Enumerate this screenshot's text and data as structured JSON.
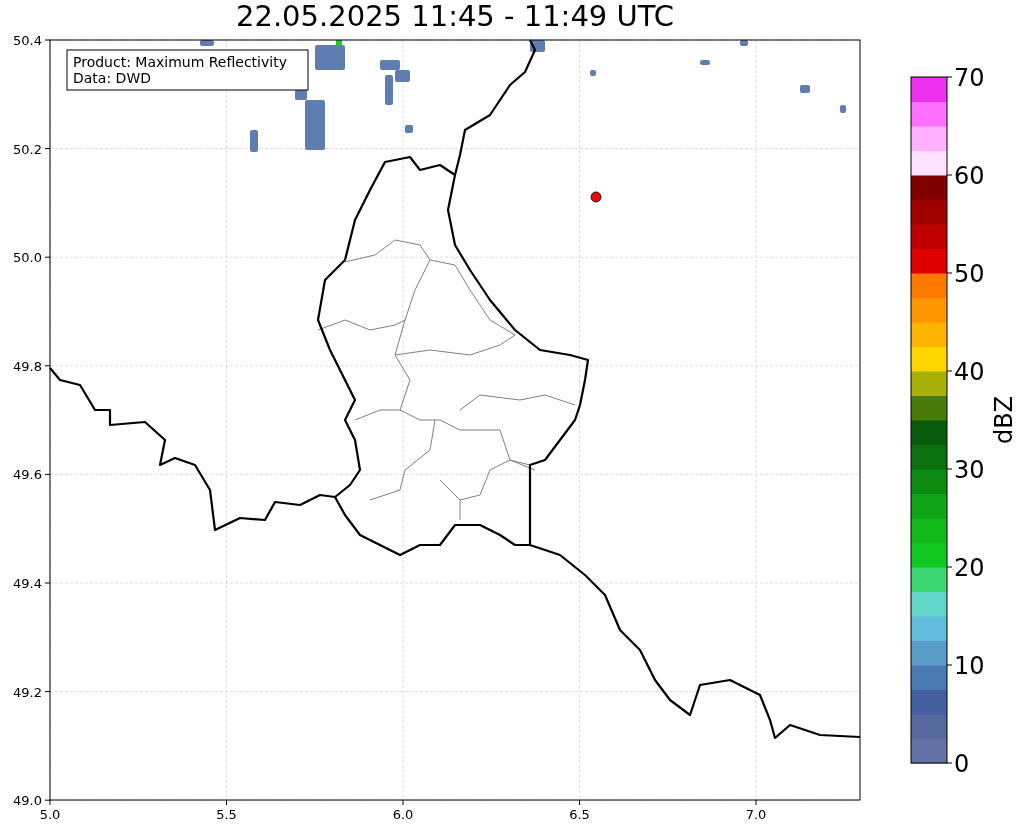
{
  "title": "22.05.2025 11:45 - 11:49 UTC",
  "info_box": [
    "Product: Maximum Reflectivity",
    "Data: DWD"
  ],
  "x_ticks": [
    "5.0",
    "5.5",
    "6.0",
    "6.5",
    "7.0"
  ],
  "y_ticks": [
    "50.4",
    "50.2",
    "50.0",
    "49.8",
    "49.6",
    "49.4",
    "49.2",
    "49.0"
  ],
  "colorbar": {
    "label": "dBZ",
    "ticks": [
      "70",
      "60",
      "50",
      "40",
      "30",
      "20",
      "10",
      "0"
    ],
    "bins": [
      {
        "color": "#6272a4"
      },
      {
        "color": "#56689e"
      },
      {
        "color": "#4460a0"
      },
      {
        "color": "#4a7ab0"
      },
      {
        "color": "#5a9ec8"
      },
      {
        "color": "#62bcdc"
      },
      {
        "color": "#62d6c8"
      },
      {
        "color": "#3cd672"
      },
      {
        "color": "#10c820"
      },
      {
        "color": "#10b818"
      },
      {
        "color": "#0fa516"
      },
      {
        "color": "#0c8a12"
      },
      {
        "color": "#0a7010"
      },
      {
        "color": "#085a0c"
      },
      {
        "color": "#4a7a0a"
      },
      {
        "color": "#aab00a"
      },
      {
        "color": "#ffd700"
      },
      {
        "color": "#ffb400"
      },
      {
        "color": "#ff9600"
      },
      {
        "color": "#ff7800"
      },
      {
        "color": "#e00000"
      },
      {
        "color": "#c00000"
      },
      {
        "color": "#a00000"
      },
      {
        "color": "#800000"
      },
      {
        "color": "#ffe0ff"
      },
      {
        "color": "#ffb0ff"
      },
      {
        "color": "#ff70ff"
      },
      {
        "color": "#ee30ee"
      }
    ]
  }
}
